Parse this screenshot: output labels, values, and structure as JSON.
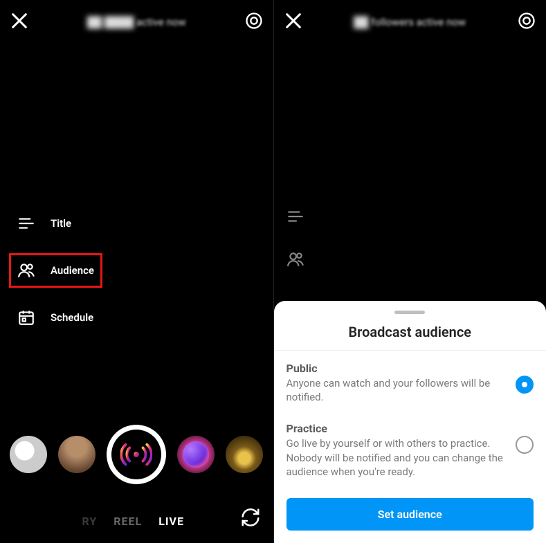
{
  "left": {
    "header_status": "active now",
    "options": {
      "title": "Title",
      "audience": "Audience",
      "schedule": "Schedule"
    },
    "modes": {
      "story": "RY",
      "reel": "REEL",
      "live": "LIVE"
    }
  },
  "right": {
    "header_status": "followers active now",
    "sheet": {
      "title": "Broadcast audience",
      "options": [
        {
          "key": "public",
          "title": "Public",
          "desc": "Anyone can watch and your followers will be notified.",
          "selected": true
        },
        {
          "key": "practice",
          "title": "Practice",
          "desc": "Go live by yourself or with others to practice. Nobody will be notified and you can change the audience when you're ready.",
          "selected": false
        }
      ],
      "button": "Set audience"
    }
  }
}
